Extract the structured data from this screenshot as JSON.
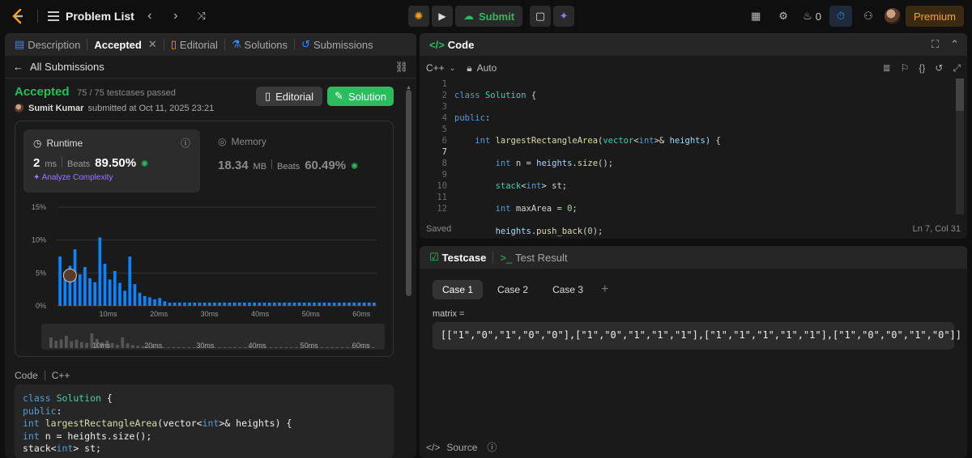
{
  "topbar": {
    "problem_list": "Problem List",
    "submit": "Submit",
    "streak": "0",
    "premium": "Premium"
  },
  "left": {
    "tabs": [
      {
        "label": "Description"
      },
      {
        "label": "Accepted"
      },
      {
        "label": "Editorial"
      },
      {
        "label": "Solutions"
      },
      {
        "label": "Submissions"
      }
    ],
    "all_submissions": "All Submissions",
    "status": "Accepted",
    "testcases": "75 / 75 testcases passed",
    "user": "Sumit Kumar",
    "submitted_at": "submitted at Oct 11, 2025 23:21",
    "editorial_btn": "Editorial",
    "solution_btn": "Solution",
    "runtime": {
      "label": "Runtime",
      "value": "2",
      "unit": "ms",
      "beats_label": "Beats",
      "beats": "89.50%",
      "analyze": "Analyze Complexity"
    },
    "memory": {
      "label": "Memory",
      "value": "18.34",
      "unit": "MB",
      "beats_label": "Beats",
      "beats": "60.49%"
    },
    "code_label": "Code",
    "code_lang": "C++",
    "code_preview": [
      "class Solution {",
      "public:",
      "    int largestRectangleArea(vector<int>& heights) {",
      "        int n = heights.size();",
      "        stack<int> st;"
    ]
  },
  "chart_data": {
    "type": "bar",
    "y_ticks": [
      "15%",
      "10%",
      "5%",
      "0%"
    ],
    "x_ticks": [
      "10ms",
      "20ms",
      "30ms",
      "40ms",
      "50ms",
      "60ms"
    ],
    "ylim": [
      0,
      15
    ],
    "values": [
      7.5,
      5.2,
      6.1,
      8.6,
      4.8,
      5.9,
      4.2,
      3.6,
      10.4,
      6.4,
      4.0,
      5.3,
      3.5,
      2.3,
      7.5,
      3.3,
      2.0,
      1.5,
      1.3,
      1.0,
      1.2,
      0.7,
      0.5,
      0.5,
      0.5,
      0.5,
      0.5,
      0.5,
      0.5,
      0.5,
      0.5,
      0.5,
      0.5,
      0.5,
      0.5,
      0.5,
      0.5,
      0.5,
      0.5,
      0.5,
      0.5,
      0.5,
      0.5,
      0.5,
      0.5,
      0.5,
      0.5,
      0.5,
      0.5,
      0.5,
      0.5,
      0.5,
      0.5,
      0.5,
      0.5,
      0.5,
      0.5,
      0.5,
      0.5,
      0.5,
      0.5,
      0.5,
      0.5,
      0.5
    ],
    "highlight_index": 2,
    "bar_color": "#0a84ff"
  },
  "code_panel": {
    "title": "Code",
    "lang": "C++",
    "auto": "Auto",
    "line_numbers": [
      "1",
      "2",
      "3",
      "4",
      "5",
      "6",
      "7",
      "8",
      "9",
      "10",
      "11",
      "12"
    ],
    "status_left": "Saved",
    "status_right": "Ln 7, Col 31"
  },
  "test_panel": {
    "tab_testcase": "Testcase",
    "tab_result": "Test Result",
    "cases": [
      "Case 1",
      "Case 2",
      "Case 3"
    ],
    "matrix_label": "matrix =",
    "matrix_value": "[[\"1\",\"0\",\"1\",\"0\",\"0\"],[\"1\",\"0\",\"1\",\"1\",\"1\"],[\"1\",\"1\",\"1\",\"1\",\"1\"],[\"1\",\"0\",\"0\",\"1\",\"0\"]]",
    "source": "Source"
  },
  "colors": {
    "accent": "#2cbb5d",
    "premium": "#ffa116",
    "bar": "#0a84ff"
  }
}
